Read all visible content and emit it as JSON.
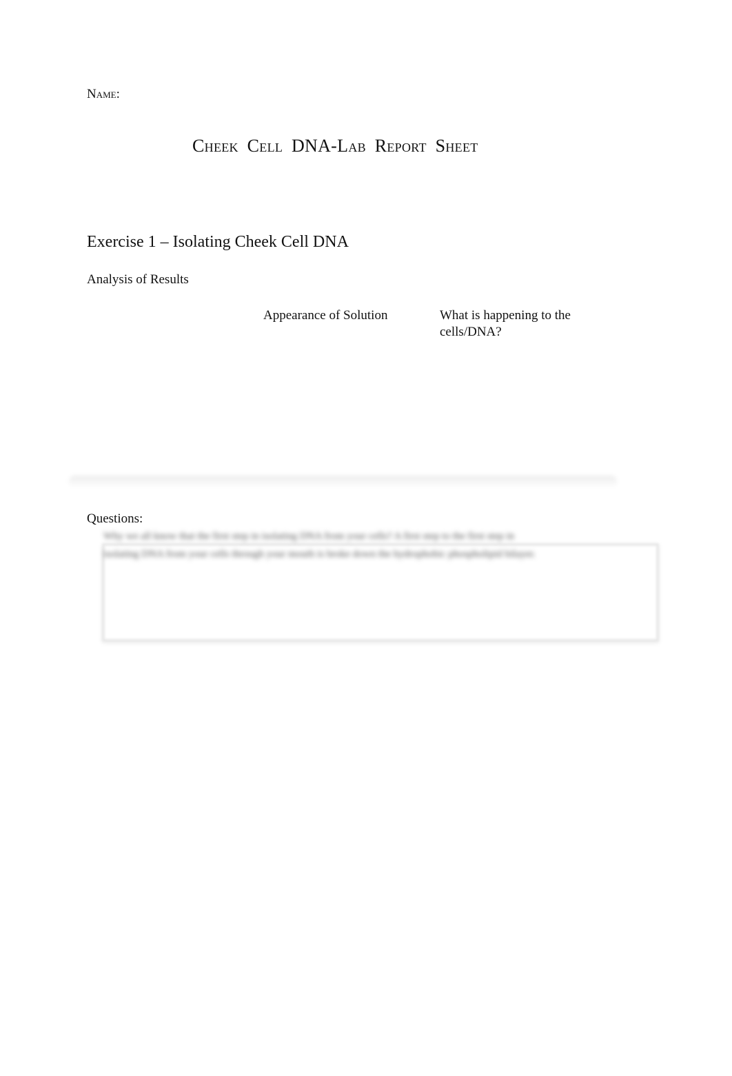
{
  "header": {
    "name_label": "Name:",
    "title": "Cheek Cell DNA-Lab Report Sheet"
  },
  "exercise": {
    "heading": "Exercise 1 – Isolating Cheek Cell DNA",
    "analysis_heading": "Analysis of Results",
    "table_columns": [
      "",
      "Appearance of Solution",
      "What is happening to the cells/DNA?"
    ]
  },
  "questions": {
    "heading": "Questions:",
    "blurred_question": "Why we all know that the first step in isolating DNA from your cells?",
    "blurred_answer": "A first step to the first step in isolating DNA from your cells through your mouth is broke down the hydrophobic phospholipid bilayer."
  }
}
